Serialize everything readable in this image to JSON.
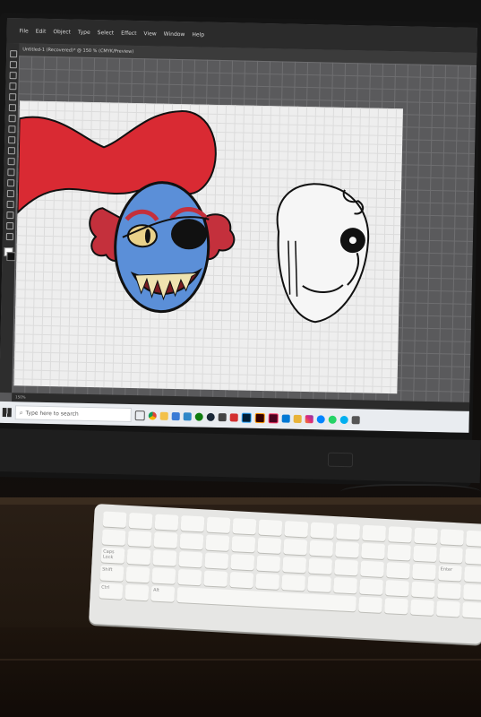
{
  "app": {
    "menu": [
      "File",
      "Edit",
      "Object",
      "Type",
      "Select",
      "Effect",
      "View",
      "Window",
      "Help"
    ],
    "document_tab": "Untitled-1 (Recovered)* @ 150 % (CMYK/Preview)",
    "zoom_status": "150%"
  },
  "taskbar": {
    "search_placeholder": "Type here to search"
  },
  "keyboard": {
    "labels": [
      "Caps Lock",
      "Ctrl",
      "Alt",
      "Enter",
      "Shift"
    ]
  },
  "colors": {
    "red_hair": "#d92a33",
    "face_blue": "#5b8fd8",
    "fin_red": "#c4303c",
    "eye_yellow": "#e9d18a",
    "teeth": "#efe3b0",
    "outline": "#111111"
  },
  "icons": [
    "windows-start-icon",
    "search-icon",
    "illustrator-icon",
    "chrome-icon",
    "explorer-icon",
    "mail-icon",
    "whatsapp-icon",
    "skype-icon",
    "instagram-icon",
    "messenger-icon"
  ]
}
